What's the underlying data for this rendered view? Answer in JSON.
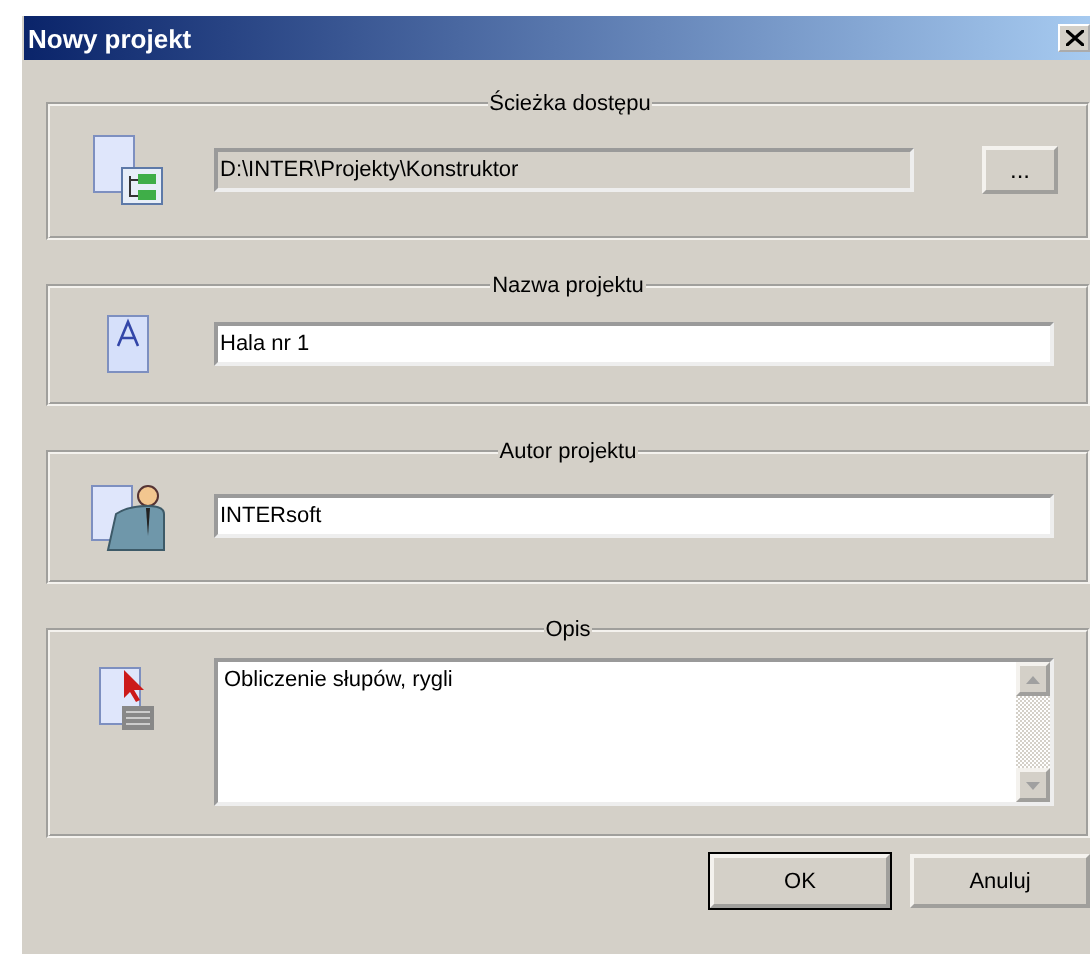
{
  "window": {
    "title": "Nowy projekt"
  },
  "sections": [
    {
      "kind": "path",
      "legend": "Ścieżka dostępu",
      "value": "D:\\INTER\\Projekty\\Konstruktor",
      "readonly": true,
      "browse": "..."
    },
    {
      "kind": "line",
      "legend": "Nazwa projektu",
      "value": "Hala nr 1",
      "readonly": false
    },
    {
      "kind": "line",
      "legend": "Autor projektu",
      "value": "INTERsoft",
      "readonly": false
    },
    {
      "kind": "memo",
      "legend": "Opis",
      "value": "Obliczenie słupów, rygli",
      "readonly": false
    }
  ],
  "buttons": [
    {
      "label": "OK",
      "default": true
    },
    {
      "label": "Anuluj",
      "default": false
    }
  ]
}
